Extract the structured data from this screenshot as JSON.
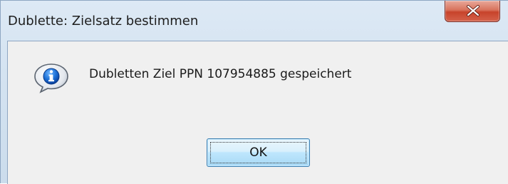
{
  "window": {
    "title": "Dublette: Zielsatz bestimmen",
    "close_icon": "close-icon"
  },
  "dialog": {
    "icon": "info-icon",
    "message": "Dubletten Ziel PPN 107954885 gespeichert",
    "ok_label": "OK"
  },
  "colors": {
    "dialog_background": "#f0f0f0",
    "titlebar": "#d4e3f1",
    "close_button": "#c7432b",
    "button_border": "#3c7fb1"
  }
}
